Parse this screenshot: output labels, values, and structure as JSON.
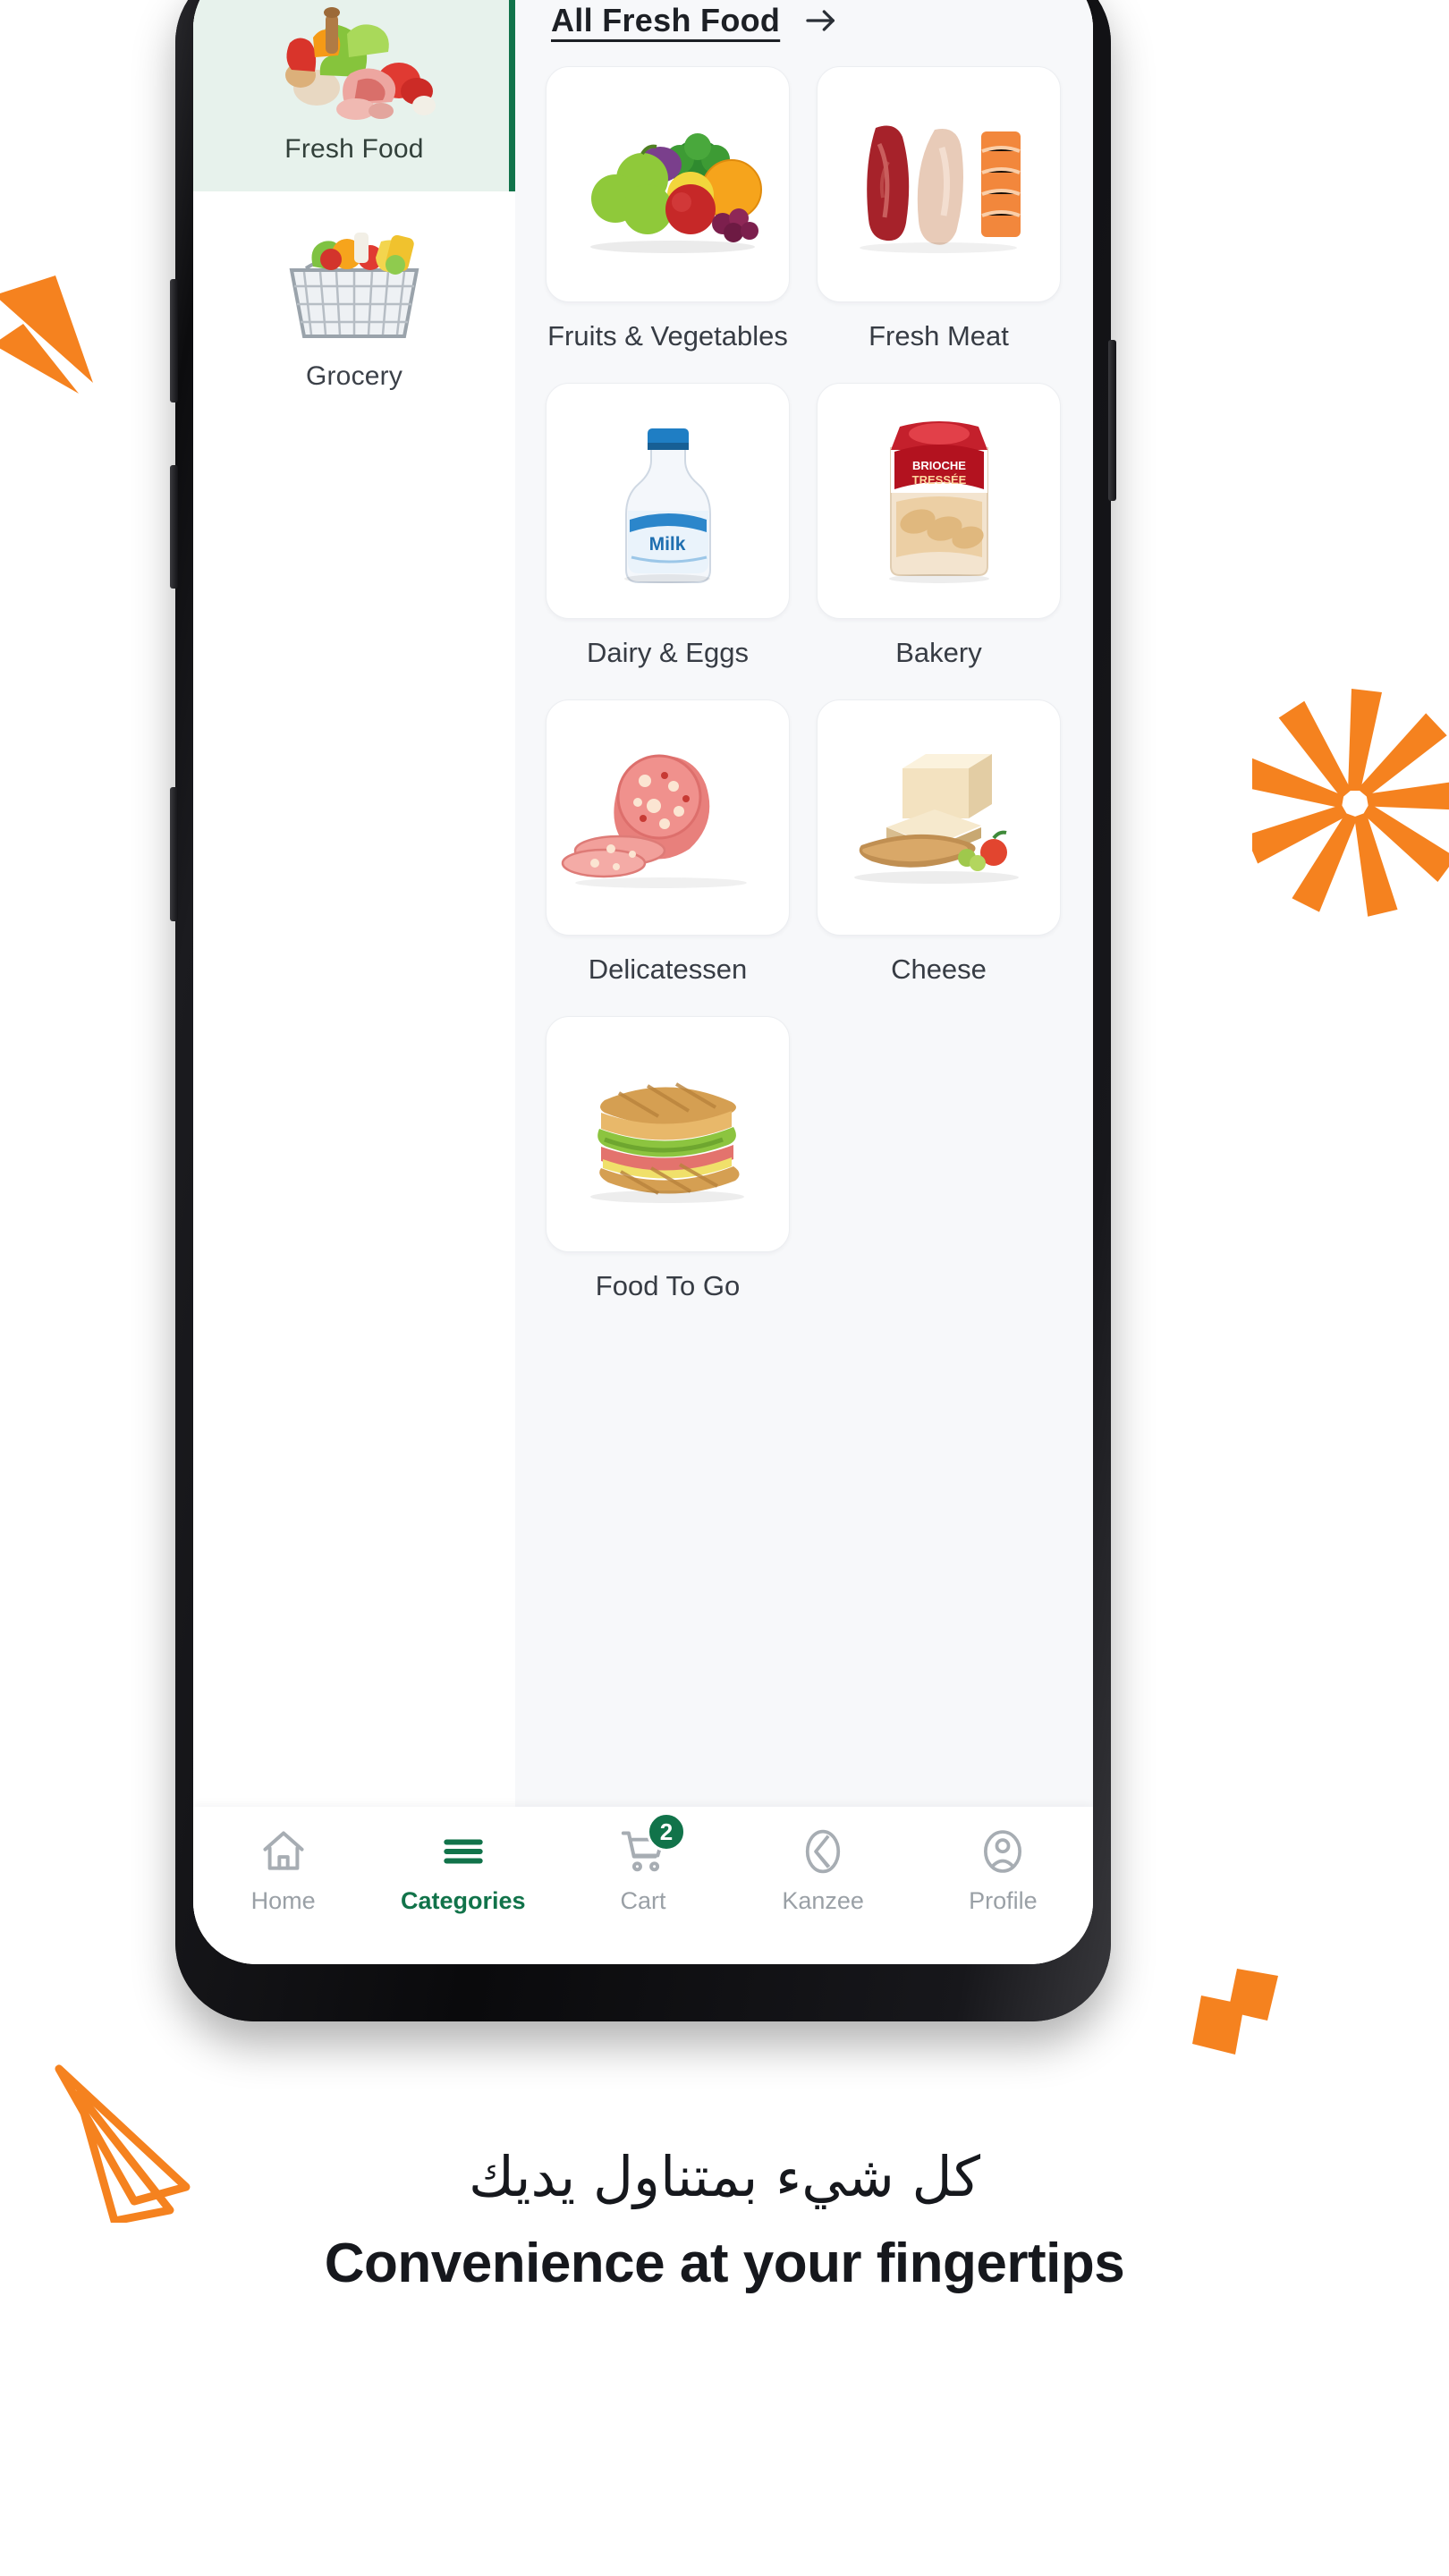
{
  "theme": {
    "brand_green": "#11734a",
    "active_tint": "#e7f2ec",
    "accent_orange": "#F5821F",
    "screen_bg": "#f7f8fa",
    "muted_text": "#9aa0a6"
  },
  "sidebar": {
    "items": [
      {
        "label": "Fresh Food",
        "icon": "fresh-food-thumb",
        "active": true
      },
      {
        "label": "Grocery",
        "icon": "grocery-basket-thumb",
        "active": false
      }
    ]
  },
  "content": {
    "header_link": "All Fresh Food",
    "header_arrow_icon": "arrow-right-icon",
    "categories": [
      {
        "label": "Fruits & Vegetables",
        "icon": "fruits-vegetables-image"
      },
      {
        "label": "Fresh Meat",
        "icon": "fresh-meat-image"
      },
      {
        "label": "Dairy & Eggs",
        "icon": "milk-bottle-image"
      },
      {
        "label": "Bakery",
        "icon": "bread-package-image"
      },
      {
        "label": "Delicatessen",
        "icon": "mortadella-image"
      },
      {
        "label": "Cheese",
        "icon": "cheese-wedge-image"
      },
      {
        "label": "Food To Go",
        "icon": "sandwich-image"
      }
    ]
  },
  "bottom_nav": {
    "items": [
      {
        "label": "Home",
        "icon": "home-icon",
        "active": false,
        "badge": ""
      },
      {
        "label": "Categories",
        "icon": "menu-lines-icon",
        "active": true,
        "badge": ""
      },
      {
        "label": "Cart",
        "icon": "shopping-cart-icon",
        "active": false,
        "badge": "2"
      },
      {
        "label": "Kanzee",
        "icon": "kanzee-logo-icon",
        "active": false,
        "badge": ""
      },
      {
        "label": "Profile",
        "icon": "user-profile-icon",
        "active": false,
        "badge": ""
      }
    ]
  },
  "taglines": {
    "arabic": "كل شيء بمتناول يديك",
    "english": "Convenience at your fingertips"
  },
  "decorations": [
    {
      "name": "paper-plane-solid-left",
      "color": "#F5821F"
    },
    {
      "name": "orange-starburst-right",
      "color": "#F5821F"
    },
    {
      "name": "paper-plane-outline-bottom-left",
      "color": "#F5821F"
    },
    {
      "name": "orange-chips-bottom-right",
      "color": "#F5821F"
    }
  ]
}
